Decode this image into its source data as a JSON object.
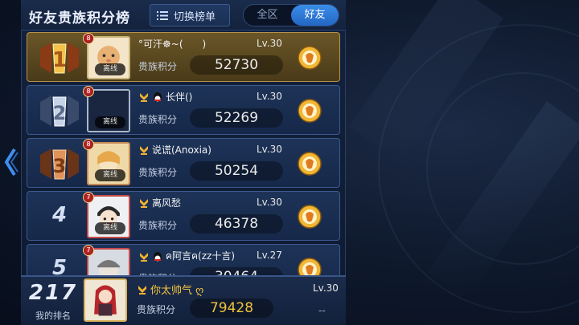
{
  "header": {
    "title": "好友贵族积分榜",
    "switch_label": "切换榜单",
    "tabs": [
      {
        "label": "全区"
      },
      {
        "label": "好友"
      }
    ]
  },
  "score_label": "贵族积分",
  "offline_label": "离线",
  "rows": [
    {
      "rank": "1",
      "name": "°可汗☸~(　　)",
      "level": "Lv.30",
      "score": "52730",
      "badge": "8"
    },
    {
      "rank": "2",
      "name": "长伴()",
      "level": "Lv.30",
      "score": "52269",
      "badge": "8"
    },
    {
      "rank": "3",
      "name": "说谎(Anoxia)",
      "level": "Lv.30",
      "score": "50254",
      "badge": "8"
    },
    {
      "rank": "4",
      "name": "离风愁",
      "level": "Lv.30",
      "score": "46378",
      "badge": "7"
    },
    {
      "rank": "5",
      "name": "ค阿言ค(zz十言)",
      "level": "Lv.27",
      "score": "30464",
      "badge": "7"
    }
  ],
  "me": {
    "rank": "217",
    "rank_label": "我的排名",
    "name": "你太帅气 ღ",
    "level": "Lv.30",
    "score": "79428",
    "dash": "--"
  },
  "colors": {
    "accent": "#2f7fe0",
    "gold": "#f0c23c"
  }
}
